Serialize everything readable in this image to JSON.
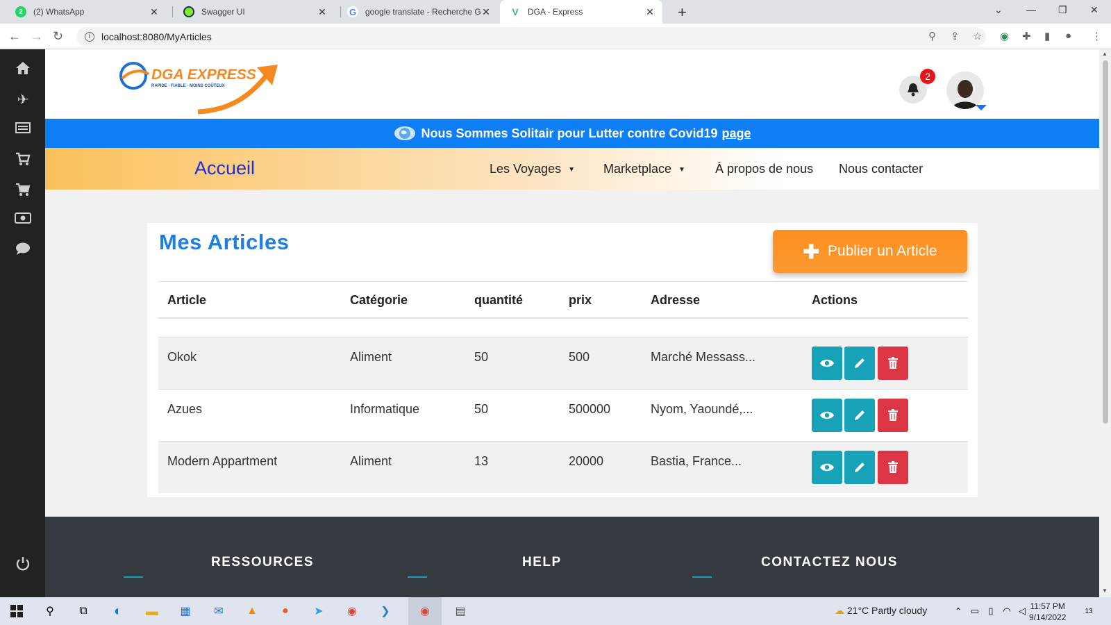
{
  "browser": {
    "tabs": [
      {
        "title": "(2) WhatsApp",
        "active": false
      },
      {
        "title": "Swagger UI",
        "active": false
      },
      {
        "title": "google translate - Recherche Goo",
        "active": false
      },
      {
        "title": "DGA - Express",
        "active": true
      }
    ],
    "url": "localhost:8080/MyArticles"
  },
  "header": {
    "logo_text": "DGA EXPRESS",
    "logo_tagline": "RAPIDE - FIABLE - MOINS COÛTEUX",
    "notification_count": "2"
  },
  "banner": {
    "text": "Nous Sommes Solitair pour Lutter contre Covid19",
    "link": "page"
  },
  "nav": {
    "home": "Accueil",
    "items": [
      {
        "label": "Les Voyages",
        "has_caret": true
      },
      {
        "label": "Marketplace",
        "has_caret": true
      },
      {
        "label": "À propos de nous",
        "has_caret": false
      },
      {
        "label": "Nous contacter",
        "has_caret": false
      }
    ]
  },
  "main": {
    "title": "Mes Articles",
    "publish_button": "Publier un Article",
    "columns": [
      "Article",
      "Catégorie",
      "quantité",
      "prix",
      "Adresse",
      "Actions"
    ],
    "rows": [
      {
        "article": "Okok",
        "categorie": "Aliment",
        "quantite": "50",
        "prix": "500",
        "adresse": "Marché Messass..."
      },
      {
        "article": "Azues",
        "categorie": "Informatique",
        "quantite": "50",
        "prix": "500000",
        "adresse": "Nyom, Yaoundé,..."
      },
      {
        "article": "Modern Appartment",
        "categorie": "Aliment",
        "quantite": "13",
        "prix": "20000",
        "adresse": "Bastia, France..."
      }
    ]
  },
  "footer": {
    "headings": [
      "RESSOURCES",
      "HELP",
      "CONTACTEZ NOUS"
    ]
  },
  "taskbar": {
    "weather": "21°C  Partly cloudy",
    "time": "11:57 PM",
    "date": "9/14/2022",
    "notifications": "13"
  },
  "colors": {
    "brand_blue": "#1f7fe0",
    "banner_blue": "#0d7ef3",
    "orange": "#ff8f1f",
    "teal": "#18a2b8",
    "danger": "#dc3545"
  }
}
